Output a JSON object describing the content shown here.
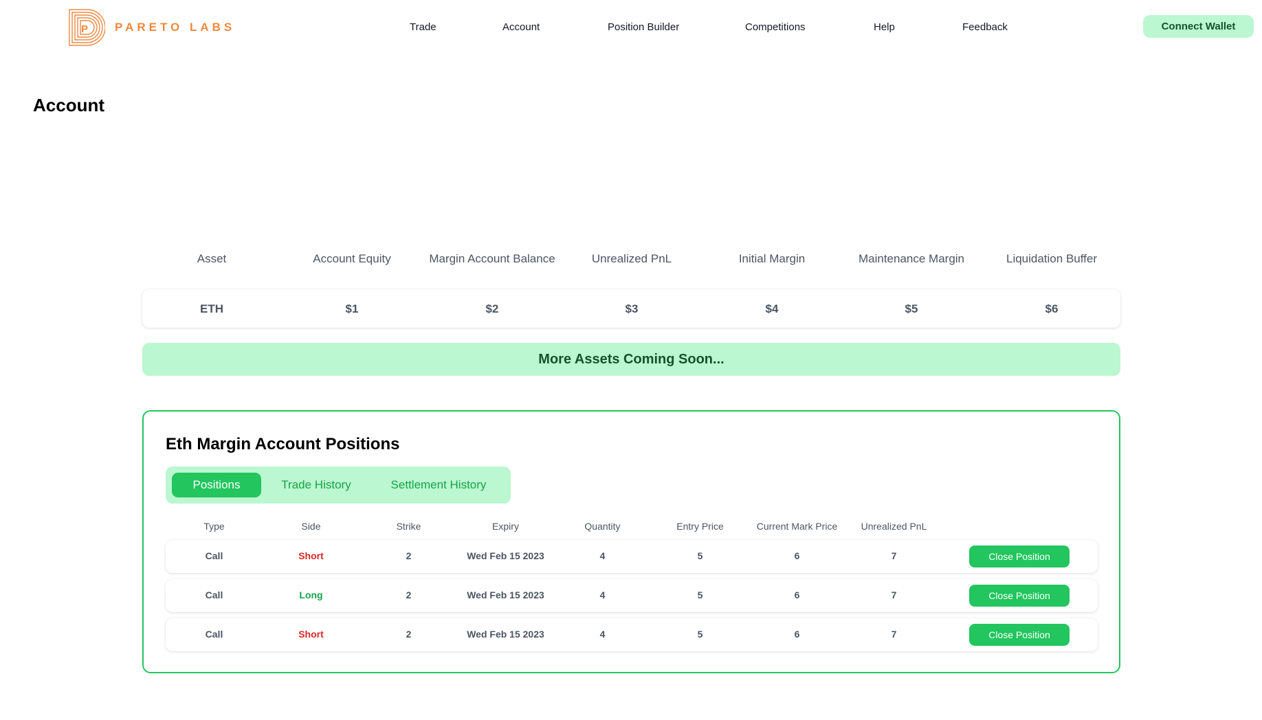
{
  "brand": {
    "name": "PARETO LABS",
    "color": "#f0883e",
    "logo_icon": "pareto-p-logo"
  },
  "nav": {
    "items": [
      {
        "label": "Trade"
      },
      {
        "label": "Account"
      },
      {
        "label": "Position Builder"
      },
      {
        "label": "Competitions"
      },
      {
        "label": "Help"
      },
      {
        "label": "Feedback"
      }
    ],
    "connect_wallet": "Connect Wallet"
  },
  "page": {
    "title": "Account"
  },
  "assets": {
    "columns": [
      "Asset",
      "Account Equity",
      "Margin Account Balance",
      "Unrealized PnL",
      "Initial Margin",
      "Maintenance Margin",
      "Liquidation Buffer"
    ],
    "rows": [
      [
        "ETH",
        "$1",
        "$2",
        "$3",
        "$4",
        "$5",
        "$6"
      ]
    ],
    "coming_soon": "More Assets Coming Soon..."
  },
  "positions": {
    "title": "Eth Margin Account Positions",
    "tabs": [
      {
        "label": "Positions",
        "active": true
      },
      {
        "label": "Trade History",
        "active": false
      },
      {
        "label": "Settlement History",
        "active": false
      }
    ],
    "columns": [
      "Type",
      "Side",
      "Strike",
      "Expiry",
      "Quantity",
      "Entry Price",
      "Current Mark Price",
      "Unrealized PnL"
    ],
    "rows": [
      {
        "type": "Call",
        "side": "Short",
        "strike": "2",
        "expiry": "Wed Feb 15 2023",
        "quantity": "4",
        "entry_price": "5",
        "mark_price": "6",
        "pnl": "7",
        "action": "Close Position"
      },
      {
        "type": "Call",
        "side": "Long",
        "strike": "2",
        "expiry": "Wed Feb 15 2023",
        "quantity": "4",
        "entry_price": "5",
        "mark_price": "6",
        "pnl": "7",
        "action": "Close Position"
      },
      {
        "type": "Call",
        "side": "Short",
        "strike": "2",
        "expiry": "Wed Feb 15 2023",
        "quantity": "4",
        "entry_price": "5",
        "mark_price": "6",
        "pnl": "7",
        "action": "Close Position"
      }
    ]
  },
  "colors": {
    "accent_green": "#22c55e",
    "light_green": "#bbf7d0",
    "dark_green_text": "#14532d",
    "short_red": "#dc2626",
    "long_green": "#16a34a"
  }
}
